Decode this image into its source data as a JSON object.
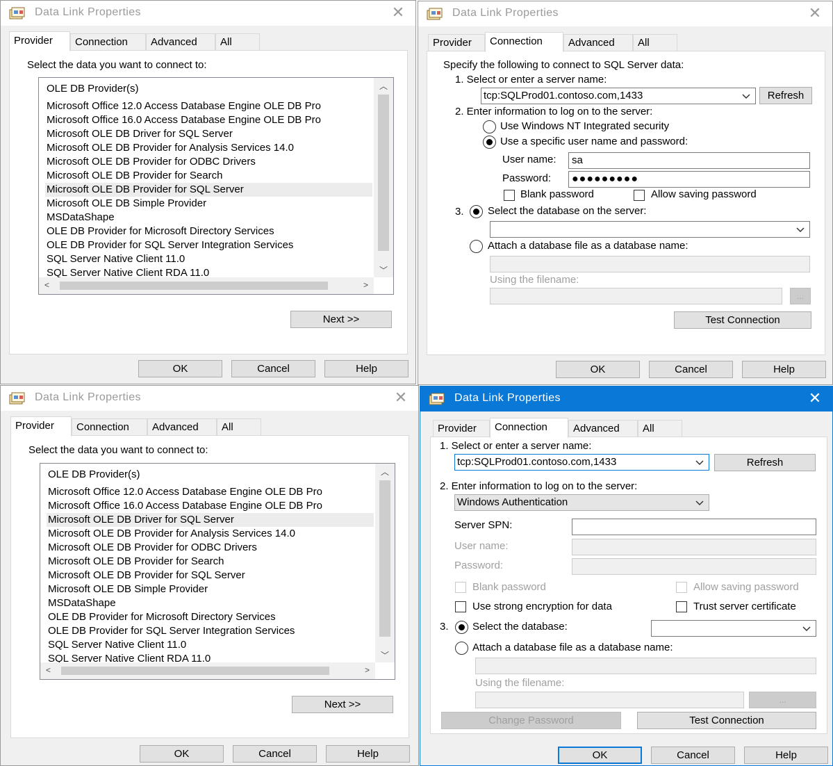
{
  "accent_color": "#0a78d7",
  "dialog_title": "Data Link Properties",
  "tabs": [
    "Provider",
    "Connection",
    "Advanced",
    "All"
  ],
  "footer": {
    "ok": "OK",
    "cancel": "Cancel",
    "help": "Help"
  },
  "provider_page": {
    "instruction": "Select the data you want to connect to:",
    "next_label": "Next >>",
    "items": [
      "OLE DB Provider(s)",
      "Microsoft Office 12.0 Access Database Engine OLE DB Pro",
      "Microsoft Office 16.0 Access Database Engine OLE DB Pro",
      "Microsoft OLE DB Driver for SQL Server",
      "Microsoft OLE DB Provider for Analysis Services 14.0",
      "Microsoft OLE DB Provider for ODBC Drivers",
      "Microsoft OLE DB Provider for Search",
      "Microsoft OLE DB Provider for SQL Server",
      "Microsoft OLE DB Simple Provider",
      "MSDataShape",
      "OLE DB Provider for Microsoft Directory Services",
      "OLE DB Provider for SQL Server Integration Services",
      "SQL Server Native Client 11.0",
      "SQL Server Native Client RDA 11.0"
    ],
    "top_selected": "Microsoft OLE DB Provider for SQL Server",
    "bottom_selected": "Microsoft OLE DB Driver for SQL Server"
  },
  "sql_provider_connection": {
    "intro": "Specify the following to connect to SQL Server data:",
    "step1": "1. Select or enter a server name:",
    "server_value": "tcp:SQLProd01.contoso.com,1433",
    "refresh": "Refresh",
    "step2": "2. Enter information to log on to the server:",
    "radio_windows": "Use Windows NT Integrated security",
    "radio_specific": "Use a specific user name and password:",
    "user_label": "User name:",
    "user_value": "sa",
    "password_label": "Password:",
    "password_value": "●●●●●●●●●",
    "blank_password": "Blank password",
    "allow_saving": "Allow saving password",
    "step3_num": "3.",
    "radio_select_db": "Select the database on the server:",
    "radio_attach": "Attach a database file as a database name:",
    "using_filename": "Using the filename:",
    "browse": "...",
    "test": "Test Connection"
  },
  "msoledb_connection": {
    "step1": "1. Select or enter a server name:",
    "server_value": "tcp:SQLProd01.contoso.com,1433",
    "refresh": "Refresh",
    "step2": "2. Enter information to log on to the server:",
    "auth_value": "Windows Authentication",
    "spn_label": "Server SPN:",
    "user_label": "User name:",
    "password_label": "Password:",
    "blank_password": "Blank password",
    "allow_saving": "Allow saving password",
    "strong_encryption": "Use strong encryption for data",
    "trust_cert": "Trust server certificate",
    "step3_num": "3.",
    "radio_select_db": "Select the database:",
    "radio_attach": "Attach a database file as a database name:",
    "using_filename": "Using the filename:",
    "browse": "...",
    "change_password": "Change Password",
    "test": "Test Connection"
  }
}
